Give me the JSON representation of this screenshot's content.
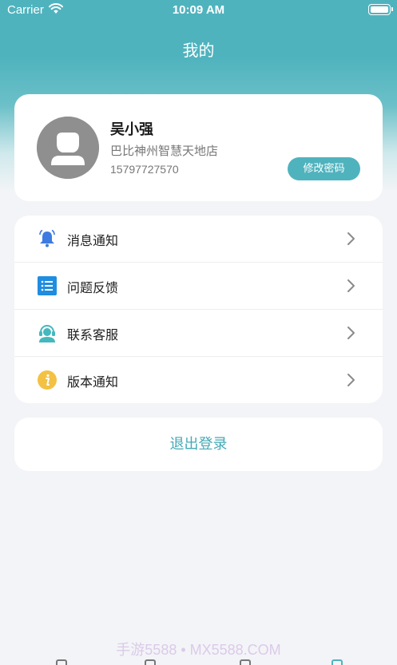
{
  "status_bar": {
    "carrier": "Carrier",
    "time": "10:09 AM"
  },
  "header": {
    "title": "我的"
  },
  "profile": {
    "name": "吴小强",
    "store": "巴比神州智慧天地店",
    "phone": "15797727570",
    "change_password_label": "修改密码"
  },
  "menu": {
    "items": [
      {
        "label": "消息通知",
        "icon": "bell-icon"
      },
      {
        "label": "问题反馈",
        "icon": "list-icon"
      },
      {
        "label": "联系客服",
        "icon": "headset-icon"
      },
      {
        "label": "版本通知",
        "icon": "info-icon"
      }
    ]
  },
  "logout": {
    "label": "退出登录"
  },
  "watermark": "手游5588 • MX5588.COM",
  "colors": {
    "accent": "#4fb3be",
    "bell": "#3e7be0",
    "list": "#1f8de0",
    "headset": "#45b8bf",
    "info": "#f3c143"
  }
}
